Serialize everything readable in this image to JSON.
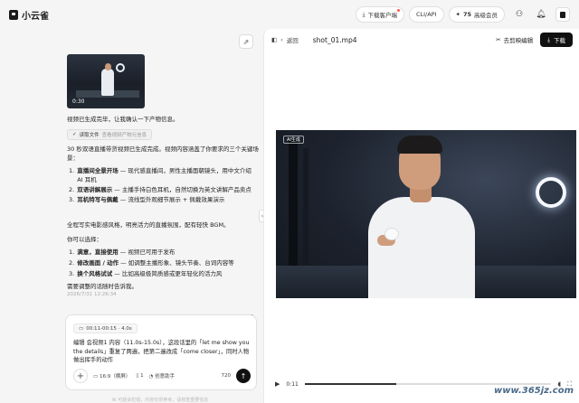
{
  "app": {
    "name": "小云雀"
  },
  "topbar": {
    "download_client": "下载客户端",
    "cli_api": "CLI/API",
    "points": "75",
    "vip": "高级会员"
  },
  "chat": {
    "thumb_time": "0:30",
    "msg1": "视频已生成完毕，让我确认一下产物信息。",
    "file_chip_label": "读取文件",
    "file_chip_sub": "查看视频产物元信息",
    "msg2": "30 秒双语直播带货视频已生成完成。视频内容涵盖了你要求的三个关键场景：",
    "scenes": [
      {
        "num": "1.",
        "title": "直播间全景开场",
        "desc": " — 现代感直播间，男性主播面朝镜头，用中文介绍 AI 耳机"
      },
      {
        "num": "2.",
        "title": "双语讲解展示",
        "desc": " — 主播手持白色耳机，自然切换为英文讲解产品卖点"
      },
      {
        "num": "3.",
        "title": "耳机特写与佩戴",
        "desc": " — 流线型外观细节展示 + 佩戴效果演示"
      }
    ],
    "msg3": "全程写实电影感风格，明亮活力的直播氛围，配有轻快 BGM。",
    "msg4": "你可以选择：",
    "options": [
      {
        "num": "1.",
        "title": "满意，直接使用",
        "desc": " — 视频已可用于发布"
      },
      {
        "num": "2.",
        "title": "修改画面 / 动作",
        "desc": " — 如调整主播形象、镜头节奏、台词内容等"
      },
      {
        "num": "3.",
        "title": "换个风格试试",
        "desc": " — 比如高级极简质感或更年轻化的活力风"
      }
    ],
    "msg5": "需要调整的话随时告诉我。",
    "timestamp": "2026/7/31 12:26:34"
  },
  "composer": {
    "clip_label": "00:11-00:15 · 4.0s",
    "text": "编辑 会视频1 内容（11.0s-15.0s），这段话里的「let me show you the details」重复了两遍，把第二遍改成「come closer」，同时人物做出挥手的动作",
    "ratio": "16:9（横屏）",
    "count": "1",
    "mode": "创意助手",
    "resolution": "720"
  },
  "disclaimer": "AI 可能会犯错，内容仅供参考，请核查重要信息",
  "preview": {
    "back": "返回",
    "file_name": "shot_01.mp4",
    "remove_watermark": "去剪映编辑",
    "download": "下载",
    "badge": "AI生成",
    "current_time": "0:11",
    "progress": 0.37
  },
  "site_watermark": "www.365jz.com"
}
